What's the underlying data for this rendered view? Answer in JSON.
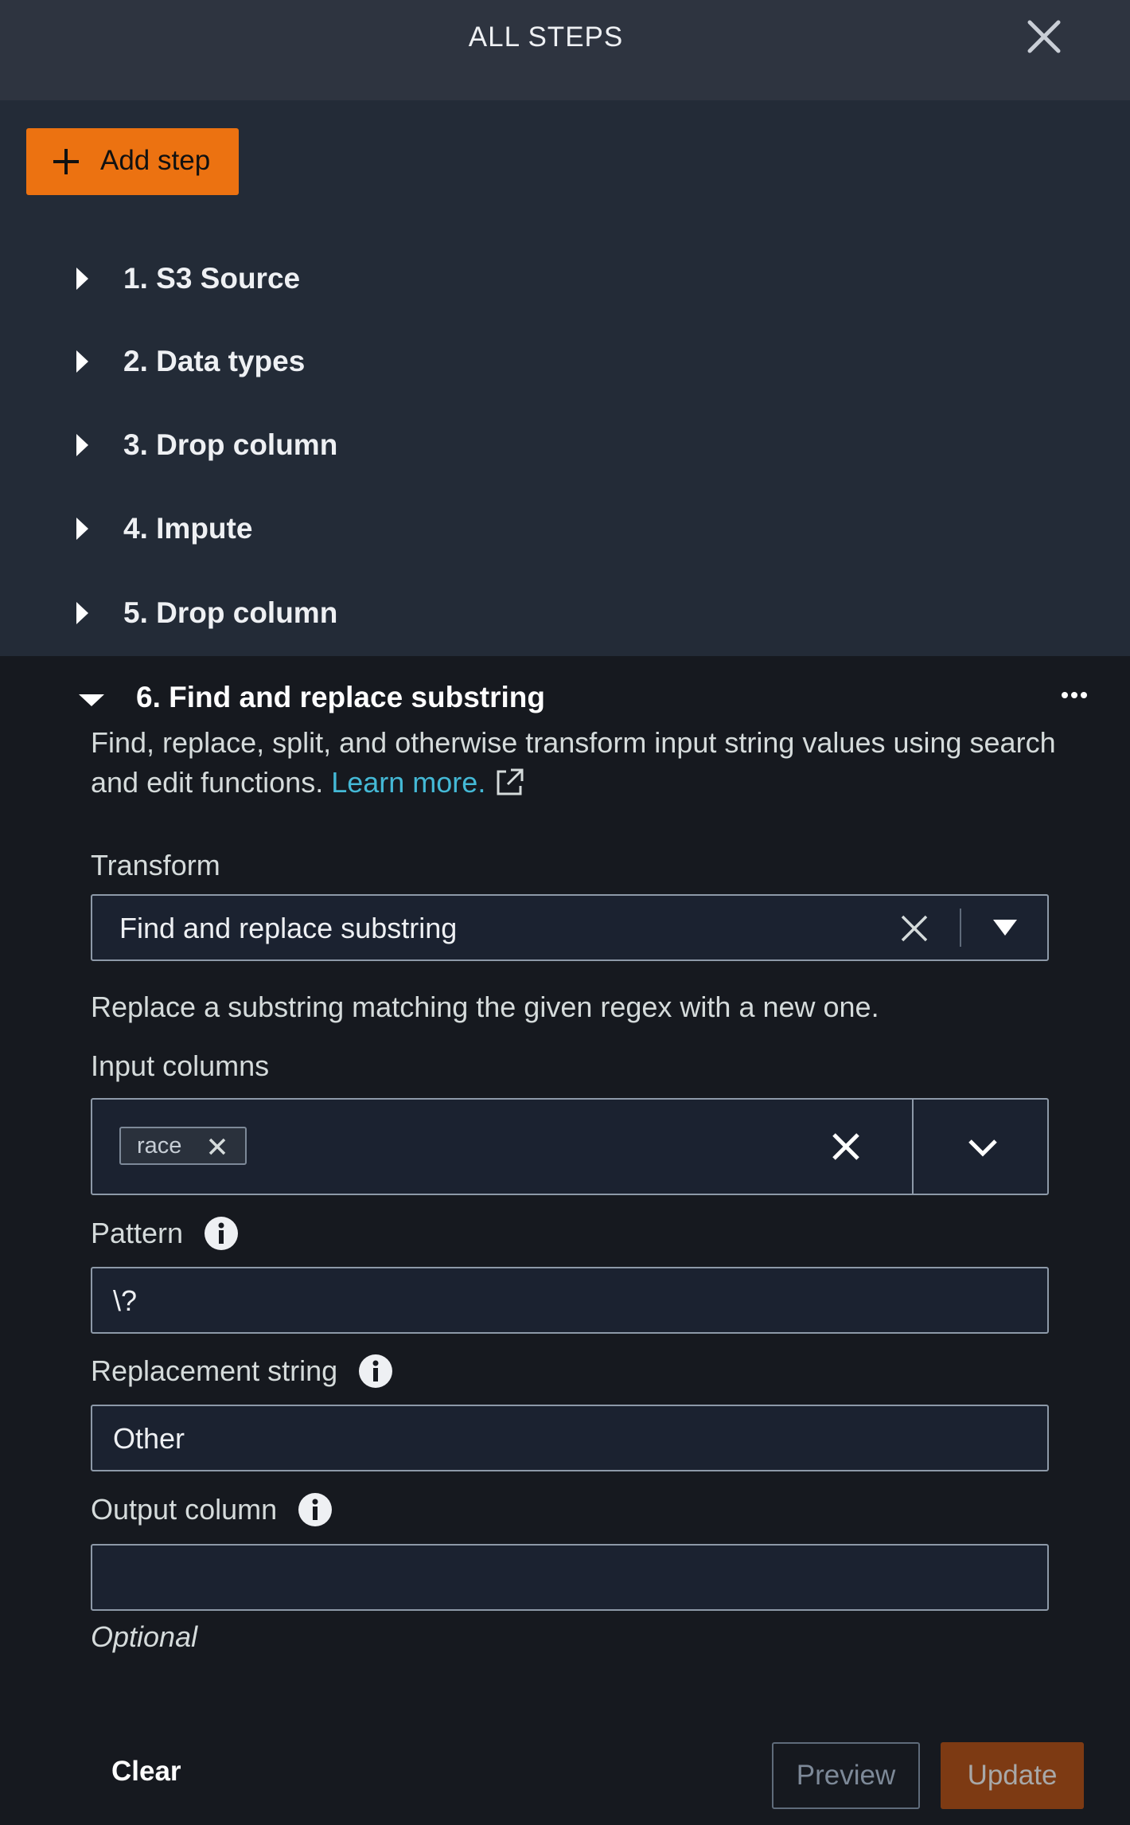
{
  "header": {
    "title": "ALL STEPS",
    "close_icon": "close-icon"
  },
  "add_step": {
    "label": "Add step",
    "icon": "plus-icon"
  },
  "steps": [
    {
      "label": "1. S3 Source"
    },
    {
      "label": "2. Data types"
    },
    {
      "label": "3. Drop column"
    },
    {
      "label": "4. Impute"
    },
    {
      "label": "5. Drop column"
    }
  ],
  "expanded_step": {
    "title": "6. Find and replace substring",
    "description": "Find, replace, split, and otherwise transform input string values using search and edit functions.",
    "learn_more": "Learn more.",
    "transform": {
      "label": "Transform",
      "value": "Find and replace substring"
    },
    "transform_help": "Replace a substring matching the given regex with a new one.",
    "input_columns": {
      "label": "Input columns",
      "tokens": [
        "race"
      ]
    },
    "pattern": {
      "label": "Pattern",
      "value": "\\?"
    },
    "replacement": {
      "label": "Replacement string",
      "value": "Other"
    },
    "output_column": {
      "label": "Output column",
      "value": "",
      "hint": "Optional"
    }
  },
  "footer": {
    "clear": "Clear",
    "preview": "Preview",
    "update": "Update"
  },
  "colors": {
    "accent": "#ec7211",
    "link": "#44b9d6",
    "header_bg": "#2e3440",
    "steps_bg": "#232b37",
    "panel_bg": "#16191f"
  }
}
